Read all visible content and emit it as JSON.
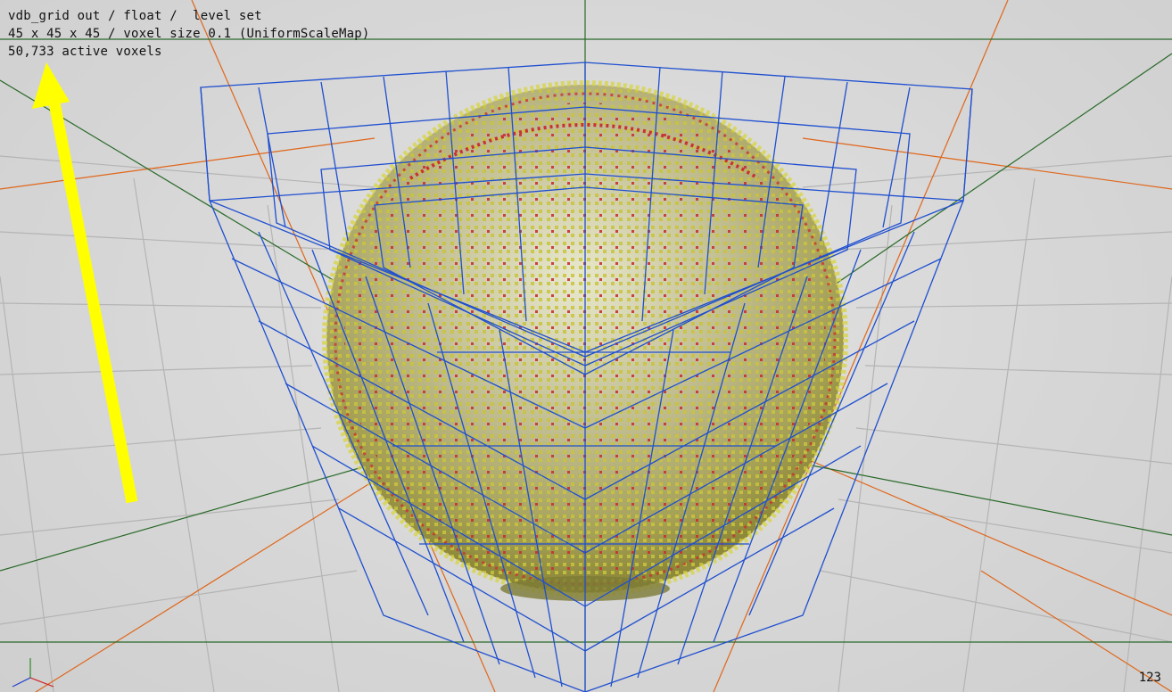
{
  "viewport": {
    "info_lines": [
      "vdb_grid out / float /  level set",
      "45 x 45 x 45 / voxel size 0.1 (UniformScaleMap)",
      "50,733 active voxels"
    ],
    "viewport_number": "123"
  },
  "colors": {
    "background": "#d8d8d8",
    "grid_lines": "#b4b4b4",
    "orange_axis": "#e0661a",
    "green_axis": "#2a6a2a",
    "bounding_box": "#1f4fd0",
    "voxel_yellow": "#c8c43c",
    "voxel_red": "#c83232",
    "annotation_arrow": "#ffff00"
  },
  "icons": {
    "axis_gizmo": "axis-gizmo-icon",
    "annotation_arrow": "annotation-arrow"
  }
}
